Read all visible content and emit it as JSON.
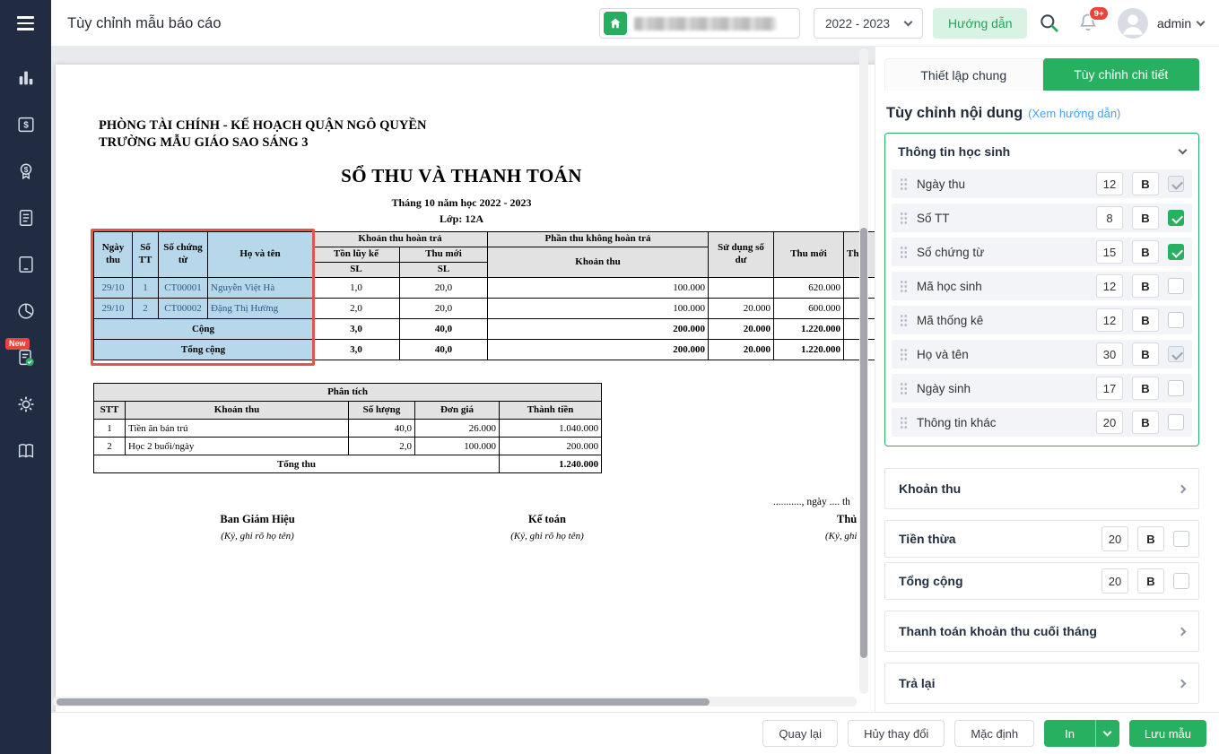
{
  "colors": {
    "accent_green": "#27b05f",
    "sidebar_navy": "#212c42",
    "highlight_blue": "#b7d7ea",
    "highlight_red_border": "#e4544c",
    "link_blue": "#4aa0f5",
    "badge_red": "#e9453e"
  },
  "header": {
    "title": "Tùy chỉnh mẫu báo cáo",
    "year_select": "2022 - 2023",
    "guide_button": "Hướng dẫn",
    "notification_badge": "9+",
    "username": "admin"
  },
  "sidebar": {
    "new_badge": "New",
    "icons": [
      "menu",
      "bar-chart",
      "invoice-dollar",
      "coin-medal",
      "document",
      "tablet",
      "pie-chart",
      "document-check",
      "gear",
      "open-book"
    ]
  },
  "document": {
    "org_line1": "PHÒNG TÀI CHÍNH - KẾ HOẠCH QUẬN NGÔ QUYỀN",
    "org_line2": "TRƯỜNG MẪU GIÁO SAO SÁNG 3",
    "title": "SỔ THU VÀ THANH TOÁN",
    "subtitle": "Tháng 10 năm học 2022 - 2023",
    "class_line": "Lớp: 12A",
    "main_table": {
      "headers": {
        "ngay_thu": "Ngày thu",
        "so_tt": "Số TT",
        "so_chung_tu": "Số chứng từ",
        "ho_va_ten": "Họ và tên",
        "khoan_thu_hoan_tra": "Khoản thu hoàn trả",
        "ton_luy_ke": "Tồn lũy kế",
        "thu_moi": "Thu mới",
        "sl1": "SL",
        "sl2": "SL",
        "phan_thu_khong_hoan_tra": "Phần thu không hoàn trả",
        "khoan_thu": "Khoản thu",
        "su_dung_so_du": "Sử dụng số dư",
        "thu_moi2": "Thu mới",
        "cut_col": "Th"
      },
      "rows": [
        {
          "c0": "29/10",
          "c1": "1",
          "c2": "CT00001",
          "c3": "Nguyễn Việt Hà",
          "c4": "1,0",
          "c5": "20,0",
          "c6": "100.000",
          "c7": "",
          "c8": "620.000"
        },
        {
          "c0": "29/10",
          "c1": "2",
          "c2": "CT00002",
          "c3": "Đặng Thị Hường",
          "c4": "2,0",
          "c5": "20,0",
          "c6": "100.000",
          "c7": "20.000",
          "c8": "600.000"
        }
      ],
      "cong": {
        "label": "Cộng",
        "c4": "3,0",
        "c5": "40,0",
        "c6": "200.000",
        "c7": "20.000",
        "c8": "1.220.000"
      },
      "tong_cong": {
        "label": "Tổng cộng",
        "c4": "3,0",
        "c5": "40,0",
        "c6": "200.000",
        "c7": "20.000",
        "c8": "1.220.000"
      }
    },
    "analysis_table": {
      "title": "Phân tích",
      "headers": [
        "STT",
        "Khoản thu",
        "Số lượng",
        "Đơn giá",
        "Thành tiền"
      ],
      "rows": [
        [
          "1",
          "Tiền ăn bán trú",
          "40,0",
          "26.000",
          "1.040.000"
        ],
        [
          "2",
          "Học 2 buổi/ngày",
          "2,0",
          "100.000",
          "200.000"
        ]
      ],
      "footer_label": "Tổng thu",
      "footer_value": "1.240.000"
    },
    "signatures": {
      "date_line": "..........., ngày .... th",
      "col1_title": "Ban Giám Hiệu",
      "col1_note": "(Ký, ghi rõ họ tên)",
      "col2_title": "Kế toán",
      "col2_note": "(Ký, ghi rõ họ tên)",
      "col3_title": "Thủ",
      "col3_note": "(Ký, ghi r"
    }
  },
  "panel": {
    "tab_general": "Thiết lập chung",
    "tab_detail": "Tùy chỉnh chi tiết",
    "heading": "Tùy chỉnh nội dung",
    "guide_link": "(Xem hướng dẫn)",
    "student_info": {
      "title": "Thông tin học sinh",
      "rows": [
        {
          "label": "Ngày thu",
          "width": "12",
          "bold": "B",
          "state": "checked-disabled"
        },
        {
          "label": "Số TT",
          "width": "8",
          "bold": "B",
          "state": "checked"
        },
        {
          "label": "Số chứng từ",
          "width": "15",
          "bold": "B",
          "state": "checked"
        },
        {
          "label": "Mã học sinh",
          "width": "12",
          "bold": "B",
          "state": "unchecked"
        },
        {
          "label": "Mã thống kê",
          "width": "12",
          "bold": "B",
          "state": "unchecked"
        },
        {
          "label": "Họ và tên",
          "width": "30",
          "bold": "B",
          "state": "checked-disabled"
        },
        {
          "label": "Ngày sinh",
          "width": "17",
          "bold": "B",
          "state": "unchecked"
        },
        {
          "label": "Thông tin khác",
          "width": "20",
          "bold": "B",
          "state": "unchecked"
        }
      ]
    },
    "section_khoan_thu": "Khoản thu",
    "row_tien_thua": {
      "label": "Tiền thừa",
      "width": "20",
      "bold": "B"
    },
    "row_tong_cong": {
      "label": "Tổng cộng",
      "width": "20",
      "bold": "B"
    },
    "section_thanh_toan": "Thanh toán khoản thu cuối tháng",
    "section_tra_lai": "Trả lại"
  },
  "footer": {
    "back": "Quay lại",
    "cancel": "Hủy thay đổi",
    "default": "Mặc định",
    "print": "In",
    "save": "Lưu mẫu"
  }
}
